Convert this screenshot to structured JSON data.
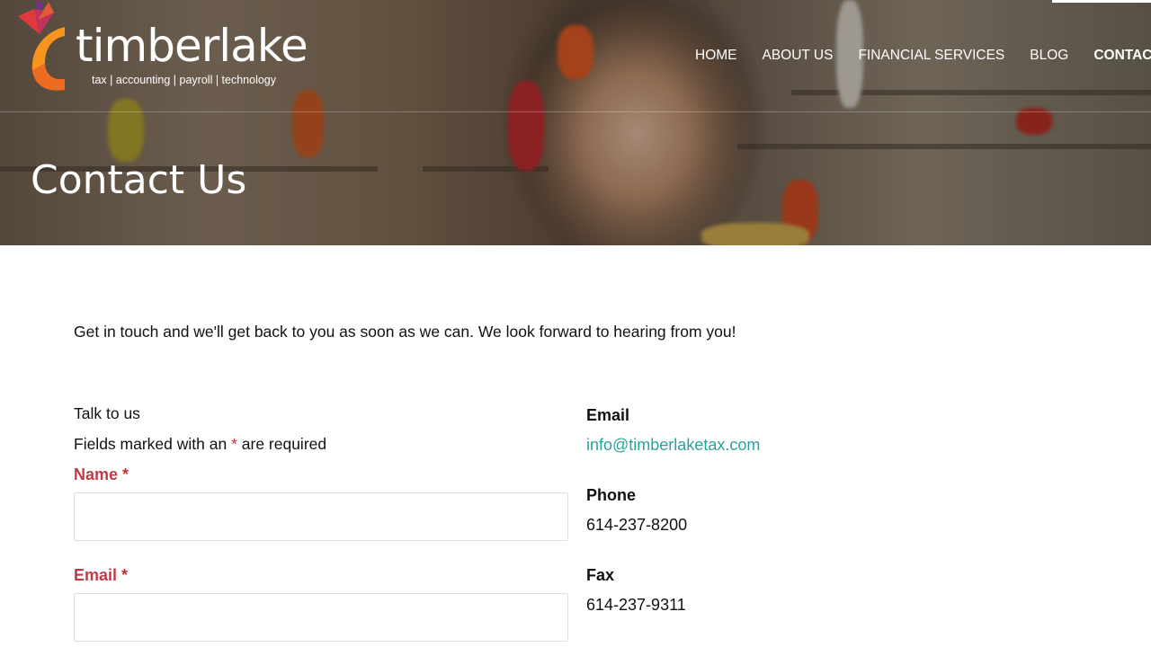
{
  "brand": {
    "name": "timberlake",
    "tagline": "tax  |  accounting  |  payroll  |  technology",
    "colors": {
      "orange": "#f7941d",
      "red": "#e03a3e",
      "purple": "#7b2d8e",
      "accent": "#2aa39a",
      "label_red": "#c23a44"
    }
  },
  "nav": {
    "items": [
      {
        "label": "HOME"
      },
      {
        "label": "ABOUT US"
      },
      {
        "label": "FINANCIAL SERVICES"
      },
      {
        "label": "BLOG"
      },
      {
        "label": "CONTACT US"
      }
    ],
    "active": "CONTACT US"
  },
  "hero": {
    "title": "Contact Us"
  },
  "intro": "Get in touch and we'll get back to you as soon as we can.  We look forward to hearing from you!",
  "form": {
    "heading": "Talk to us",
    "required_note_prefix": "Fields marked with an ",
    "required_marker": "*",
    "required_note_suffix": " are required",
    "fields": [
      {
        "label": "Name",
        "value": ""
      },
      {
        "label": "Email",
        "value": ""
      }
    ]
  },
  "contact": {
    "email_label": "Email",
    "email_value": "info@timberlaketax.com",
    "phone_label": "Phone",
    "phone_value": "614-237-8200",
    "fax_label": "Fax",
    "fax_value": "614-237-9311"
  }
}
